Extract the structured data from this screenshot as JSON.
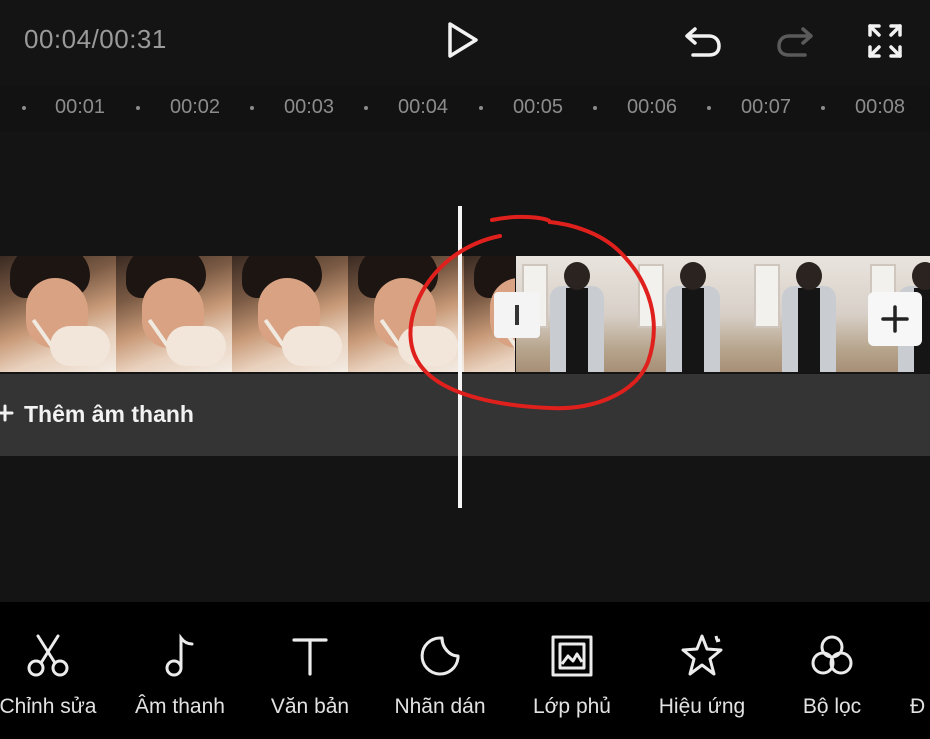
{
  "header": {
    "timecode": "00:04/00:31",
    "play_icon": "play-icon",
    "undo_icon": "undo-icon",
    "redo_icon": "redo-icon",
    "fullscreen_icon": "fullscreen-icon"
  },
  "ruler": {
    "ticks": [
      "00:01",
      "00:02",
      "00:03",
      "00:04",
      "00:05",
      "00:06",
      "00:07",
      "00:08"
    ]
  },
  "timeline": {
    "add_audio_label": "Thêm âm thanh",
    "split_icon": "split-transition-icon",
    "add_clip_icon": "plus-icon",
    "annotation_color": "#e0201c"
  },
  "toolbar": {
    "items": [
      {
        "label": "Chỉnh sửa",
        "icon": "scissors-icon"
      },
      {
        "label": "Âm thanh",
        "icon": "music-note-icon"
      },
      {
        "label": "Văn bản",
        "icon": "text-icon"
      },
      {
        "label": "Nhãn dán",
        "icon": "sticker-icon"
      },
      {
        "label": "Lớp phủ",
        "icon": "overlay-icon"
      },
      {
        "label": "Hiệu ứng",
        "icon": "effect-star-icon"
      },
      {
        "label": "Bộ lọc",
        "icon": "filter-icon"
      },
      {
        "label": "Đ"
      }
    ]
  }
}
